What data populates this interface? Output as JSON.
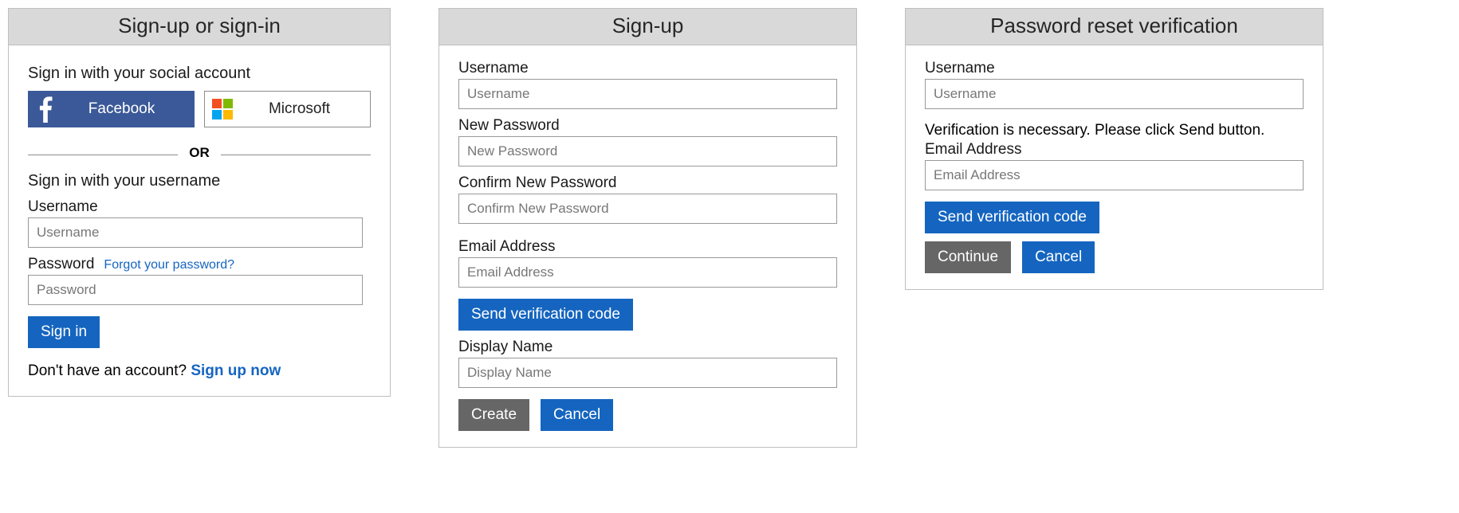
{
  "signin": {
    "title": "Sign-up or sign-in",
    "social_heading": "Sign in with your social account",
    "facebook_label": "Facebook",
    "microsoft_label": "Microsoft",
    "or_label": "OR",
    "local_heading": "Sign in with your username",
    "username_label": "Username",
    "username_placeholder": "Username",
    "password_label": "Password",
    "forgot_link": "Forgot your password?",
    "password_placeholder": "Password",
    "signin_button": "Sign in",
    "no_account_text": "Don't have an account? ",
    "signup_link": "Sign up now"
  },
  "signup": {
    "title": "Sign-up",
    "username_label": "Username",
    "username_placeholder": "Username",
    "newpw_label": "New Password",
    "newpw_placeholder": "New Password",
    "confirmpw_label": "Confirm New Password",
    "confirmpw_placeholder": "Confirm New Password",
    "email_label": "Email Address",
    "email_placeholder": "Email Address",
    "send_code_button": "Send verification code",
    "display_label": "Display Name",
    "display_placeholder": "Display Name",
    "create_button": "Create",
    "cancel_button": "Cancel"
  },
  "reset": {
    "title": "Password reset verification",
    "username_label": "Username",
    "username_placeholder": "Username",
    "info_text": "Verification is necessary. Please click Send button.",
    "email_label": "Email Address",
    "email_placeholder": "Email Address",
    "send_code_button": "Send verification code",
    "continue_button": "Continue",
    "cancel_button": "Cancel"
  }
}
